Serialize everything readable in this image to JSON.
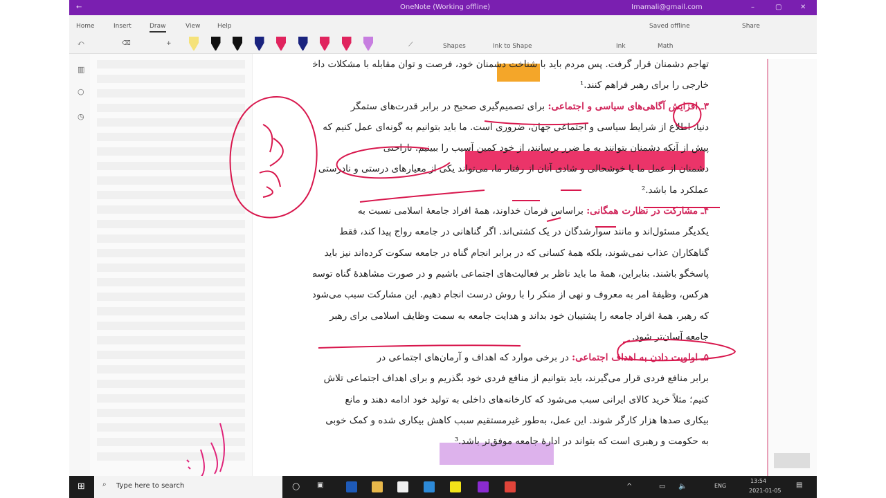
{
  "window": {
    "title": "OneNote (Working offline)",
    "account": "Imamali@gmail.com",
    "accent": "#7a1fb0"
  },
  "ribbon": {
    "tabs": [
      "Home",
      "Insert",
      "Draw",
      "View",
      "Help"
    ],
    "active": "Draw",
    "saved": "Saved offline",
    "share": "Share",
    "shapes": "Shapes",
    "ink_to_shape": "Ink to Shape",
    "ink_to_text": "Ink",
    "math": "Math",
    "pens": [
      "#f5e27a",
      "#111111",
      "#111111",
      "#1a237e",
      "#e0245e",
      "#1a237e",
      "#e0245e",
      "#e0245e",
      "#c77ee0"
    ]
  },
  "document": {
    "lines": [
      {
        "text": "تهاجم دشمنان قرار گرفت. پس مردم باید با شناخت دشمنان خود، فرصت و توان مقابله با مشکلات داخلی و"
      },
      {
        "text": "خارجی را برای رهبر فراهم کنند.¹"
      },
      {
        "heading": "۳ـ افزایش آگاهی‌های سیاسی و اجتماعی:",
        "text": " برای تصمیم‌گیری صحیح در برابر قدرت‌های ستمگر"
      },
      {
        "text": "دنیا، اطلاع از شرایط سیاسی و اجتماعی جهان، ضروری است. ما باید بتوانیم به گونه‌ای عمل کنیم که"
      },
      {
        "text": "پیش از آنکه دشمنان بتوانند به ما ضرر برسانند، از خود کمین آسیب را ببینیم. ناراحتی"
      },
      {
        "text": "دشمنان از عمل ما یا خوشحالی و شادی آنان از رفتار ما، می‌تواند یکی از معیارهای درستی و نادرستی"
      },
      {
        "text": "عملکرد ما باشد.²"
      },
      {
        "heading": "۴ـ مشارکت در نظارت همگانی:",
        "text": " براساس فرمان خداوند، همهٔ افراد جامعهٔ اسلامی نسبت به"
      },
      {
        "text": "یکدیگر مسئول‌اند و مانند سوارشدگان در یک کشتی‌اند. اگر گناهانی در جامعه رواج پیدا کند، فقط"
      },
      {
        "text": "گناهکاران عذاب نمی‌شوند، بلکه همهٔ کسانی که در برابر انجام گناه در جامعه سکوت کرده‌اند نیز باید"
      },
      {
        "text": "پاسخگو باشند. بنابراین، همهٔ ما باید ناظر بر فعالیت‌های اجتماعی باشیم و در صورت مشاهدهٔ گناه توسط"
      },
      {
        "text": "هرکس، وظیفهٔ امر به معروف و نهی از منکر را با روش درست انجام دهیم. این مشارکت سبب می‌شود"
      },
      {
        "text": "که رهبر، همهٔ افراد جامعه را پشتیبان خود بداند و هدایت جامعه به سمت وظایف اسلامی برای رهبر"
      },
      {
        "text": "جامعه آسان‌تر شود."
      },
      {
        "heading": "۵ـ اولویت دادن به اهداف اجتماعی:",
        "text": " در برخی موارد که اهداف و آرمان‌های اجتماعی در"
      },
      {
        "text": "برابر منافع فردی قرار می‌گیرند، باید بتوانیم از منافع فردی خود بگذریم و برای اهداف اجتماعی تلاش"
      },
      {
        "text": "کنیم؛ مثلاً خرید کالای ایرانی سبب می‌شود که کارخانه‌های داخلی به تولید خود ادامه دهند و مانع"
      },
      {
        "text": "بیکاری صدها هزار کارگر شوند. این عمل، به‌طور غیرمستقیم سبب کاهش بیکاری شده و کمک خوبی"
      },
      {
        "text": "به حکومت و رهبری است که بتواند در ادارهٔ جامعه موفق‌تر باشد.³"
      }
    ]
  },
  "taskbar": {
    "search_placeholder": "Type here to search",
    "time": "13:54",
    "date": "2021-01-05",
    "lang": "ENG"
  }
}
